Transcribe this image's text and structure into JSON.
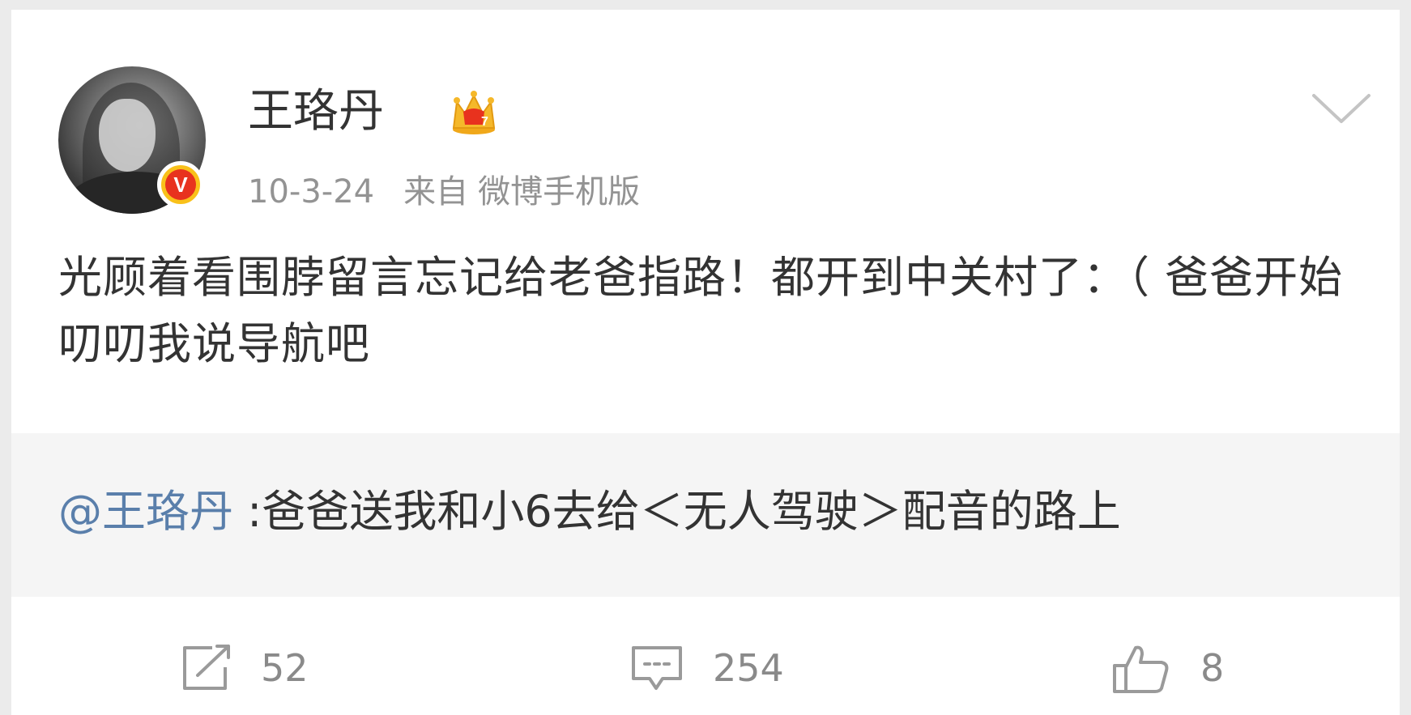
{
  "post": {
    "username": "王珞丹",
    "timestamp": "10-3-24",
    "source_label": "来自",
    "source_name": "微博手机版",
    "text": "光顾着看围脖留言忘记给老爸指路！都开到中关村了：（ 爸爸开始叨叨我说导航吧",
    "verified_badge_letter": "V",
    "badge_icon": "crown-icon",
    "more_icon": "chevron-down-icon"
  },
  "retweet": {
    "mention": "@王珞丹",
    "text": " :爸爸送我和小6去给＜无人驾驶＞配音的路上"
  },
  "actions": {
    "repost_count": "52",
    "comment_count": "254",
    "like_count": "8"
  },
  "colors": {
    "background": "#ebebeb",
    "card": "#ffffff",
    "retweet_bg": "#f5f5f5",
    "text": "#333333",
    "meta": "#939393",
    "mention": "#5a7fab",
    "verify_outer": "#f9c11a",
    "verify_inner": "#e8321e",
    "crown": "#f5b82a"
  }
}
